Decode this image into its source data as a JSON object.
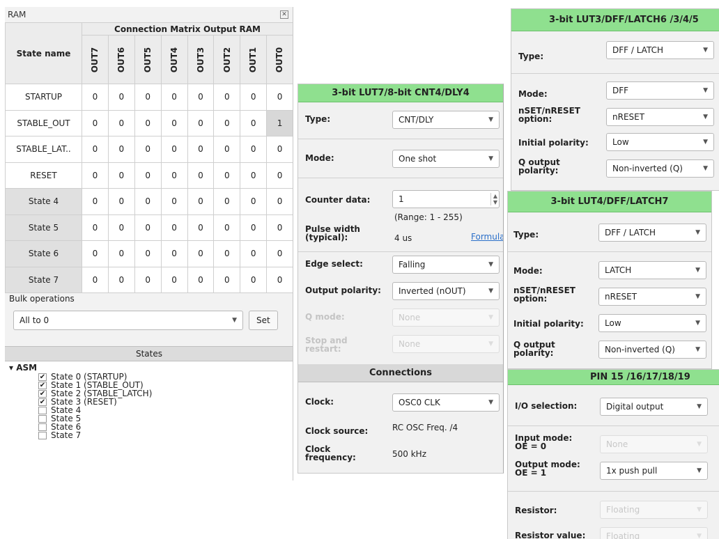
{
  "ram": {
    "title": "RAM",
    "close_glyph": "✕",
    "matrix_header": "Connection Matrix Output RAM",
    "state_name_header": "State name",
    "outputs": [
      "OUT7",
      "OUT6",
      "OUT5",
      "OUT4",
      "OUT3",
      "OUT2",
      "OUT1",
      "OUT0"
    ],
    "rows": [
      {
        "name": "STARTUP",
        "vals": [
          "0",
          "0",
          "0",
          "0",
          "0",
          "0",
          "0",
          "0"
        ]
      },
      {
        "name": "STABLE_OUT",
        "vals": [
          "0",
          "0",
          "0",
          "0",
          "0",
          "0",
          "0",
          "1"
        ]
      },
      {
        "name": "STABLE_LAT..",
        "vals": [
          "0",
          "0",
          "0",
          "0",
          "0",
          "0",
          "0",
          "0"
        ]
      },
      {
        "name": "RESET",
        "vals": [
          "0",
          "0",
          "0",
          "0",
          "0",
          "0",
          "0",
          "0"
        ]
      },
      {
        "name": "State 4",
        "vals": [
          "0",
          "0",
          "0",
          "0",
          "0",
          "0",
          "0",
          "0"
        ]
      },
      {
        "name": "State 5",
        "vals": [
          "0",
          "0",
          "0",
          "0",
          "0",
          "0",
          "0",
          "0"
        ]
      },
      {
        "name": "State 6",
        "vals": [
          "0",
          "0",
          "0",
          "0",
          "0",
          "0",
          "0",
          "0"
        ]
      },
      {
        "name": "State 7",
        "vals": [
          "0",
          "0",
          "0",
          "0",
          "0",
          "0",
          "0",
          "0"
        ]
      }
    ],
    "bulk_label": "Bulk operations",
    "bulk_value": "All to 0",
    "set_label": "Set",
    "states_header": "States",
    "asm_label": "ASM",
    "states": [
      {
        "label": "State 0 (STARTUP)",
        "checked": true
      },
      {
        "label": "State 1 (STABLE_OUT)",
        "checked": true
      },
      {
        "label": "State 2 (STABLE_LATCH)",
        "checked": true
      },
      {
        "label": "State 3 (RESET)",
        "checked": true
      },
      {
        "label": "State 4",
        "checked": false
      },
      {
        "label": "State 5",
        "checked": false
      },
      {
        "label": "State 6",
        "checked": false
      },
      {
        "label": "State 7",
        "checked": false
      }
    ]
  },
  "lut7": {
    "title": "3-bit LUT7/8-bit CNT4/DLY4",
    "type_label": "Type:",
    "type_value": "CNT/DLY",
    "mode_label": "Mode:",
    "mode_value": "One shot",
    "counter_label": "Counter data:",
    "counter_value": "1",
    "range": "(Range:  1 - 255)",
    "pulse_label": "Pulse width (typical):",
    "pulse_value": "4 us",
    "formula_link": "Formula",
    "edge_label": "Edge select:",
    "edge_value": "Falling",
    "outpol_label": "Output polarity:",
    "outpol_value": "Inverted (nOUT)",
    "qmode_label": "Q mode:",
    "qmode_value": "None",
    "stop_label": "Stop and restart:",
    "stop_value": "None",
    "connections_header": "Connections",
    "clock_label": "Clock:",
    "clock_value": "OSC0 CLK",
    "clksrc_label": "Clock source:",
    "clksrc_value": "RC OSC Freq. /4",
    "clkfreq_label": "Clock frequency:",
    "clkfreq_value": "500 kHz"
  },
  "lut3": {
    "title": "3-bit LUT3/DFF/LATCH6 /3/4/5",
    "type_label": "Type:",
    "type_value": "DFF / LATCH",
    "mode_label": "Mode:",
    "mode_value": "DFF",
    "nset_label": "nSET/nRESET option:",
    "nset_value": "nRESET",
    "initpol_label": "Initial polarity:",
    "initpol_value": "Low",
    "qout_label": "Q output polarity:",
    "qout_value": "Non-inverted (Q)"
  },
  "lut4": {
    "title": "3-bit LUT4/DFF/LATCH7",
    "type_label": "Type:",
    "type_value": "DFF / LATCH",
    "mode_label": "Mode:",
    "mode_value": "LATCH",
    "nset_label": "nSET/nRESET option:",
    "nset_value": "nRESET",
    "initpol_label": "Initial polarity:",
    "initpol_value": "Low",
    "qout_label": "Q output polarity:",
    "qout_value": "Non-inverted (Q)"
  },
  "pin": {
    "title": "PIN 15 /16/17/18/19",
    "io_label": "I/O selection:",
    "io_value": "Digital output",
    "inmode_label": "Input mode: OE = 0",
    "inmode_value": "None",
    "outmode_label": "Output mode: OE = 1",
    "outmode_value": "1x push pull",
    "resistor_label": "Resistor:",
    "resistor_value": "Floating",
    "resval_label": "Resistor value:",
    "resval_value": "Floating"
  },
  "colors": {
    "green_header": "#8fe08f",
    "grey_header": "#d8d8d8"
  }
}
